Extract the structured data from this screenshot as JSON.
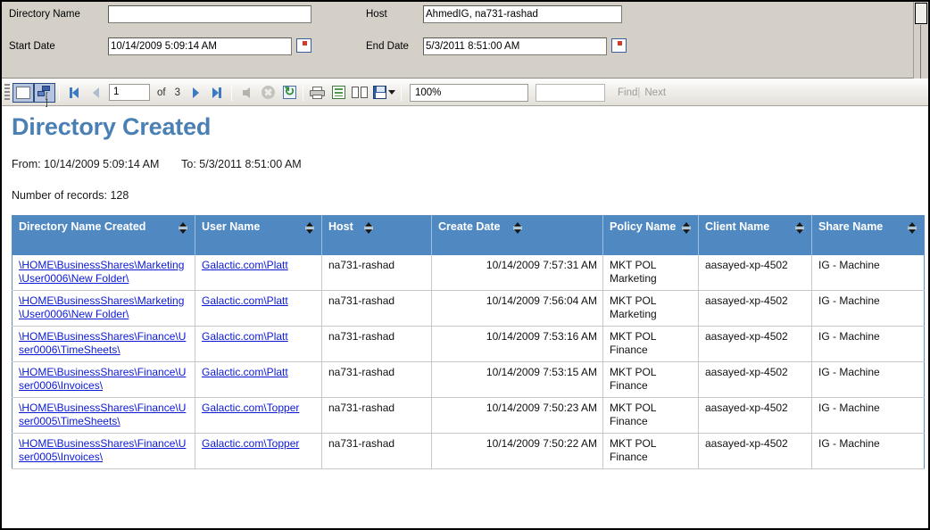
{
  "params": {
    "directory_name": {
      "label": "Directory Name",
      "value": "",
      "placeholder": ""
    },
    "host": {
      "label": "Host",
      "value": "AhmedIG, na731-rashad"
    },
    "start_date": {
      "label": "Start Date",
      "value": "10/14/2009 5:09:14 AM"
    },
    "end_date": {
      "label": "End Date",
      "value": "5/3/2011 8:51:00 AM"
    }
  },
  "toolbar": {
    "document_map_icon": "document-map-icon",
    "parameters_icon": "parameters-icon",
    "first_page_icon": "first-page-icon",
    "prev_page_icon": "previous-page-icon",
    "current_page": "1",
    "of_label": "of",
    "total_pages": "3",
    "next_page_icon": "next-page-icon",
    "last_page_icon": "last-page-icon",
    "back_icon": "back-parent-report-icon",
    "stop_icon": "stop-rendering-icon",
    "refresh_icon": "refresh-icon",
    "print_icon": "print-icon",
    "page_setup_icon": "page-setup-icon",
    "print_layout_icon": "print-layout-icon",
    "export_icon": "export-save-icon",
    "zoom_value": "100%",
    "find_label": "Find",
    "find_separator": "|",
    "next_label": "Next",
    "search_value": ""
  },
  "report": {
    "title": "Directory Created",
    "from_label": "From: 10/14/2009 5:09:14 AM",
    "to_label": "To: 5/3/2011 8:51:00 AM",
    "record_count_label": "Number of records: 128"
  },
  "table": {
    "columns": [
      {
        "label": "Directory Name Created",
        "sort": "sort-icon"
      },
      {
        "label": "User Name",
        "sort": "sort-icon"
      },
      {
        "label": "Host",
        "sort": "sort-icon"
      },
      {
        "label": "Create Date",
        "sort": "sort-icon"
      },
      {
        "label": "Policy Name",
        "sort": "sort-icon"
      },
      {
        "label": "Client Name",
        "sort": "sort-icon"
      },
      {
        "label": "Share Name",
        "sort": "sort-icon"
      }
    ],
    "rows": [
      {
        "directory": "\\HOME\\BusinessShares\\Marketing\\User0006\\New Folder\\",
        "user": "Galactic.com\\Platt",
        "host": "na731-rashad",
        "create_date": "10/14/2009 7:57:31 AM",
        "policy": "MKT POL Marketing",
        "client": "aasayed-xp-4502",
        "share": "IG - Machine"
      },
      {
        "directory": "\\HOME\\BusinessShares\\Marketing\\User0006\\New Folder\\",
        "user": "Galactic.com\\Platt",
        "host": "na731-rashad",
        "create_date": "10/14/2009 7:56:04 AM",
        "policy": "MKT POL Marketing",
        "client": "aasayed-xp-4502",
        "share": "IG - Machine"
      },
      {
        "directory": "\\HOME\\BusinessShares\\Finance\\User0006\\TimeSheets\\",
        "user": "Galactic.com\\Platt",
        "host": "na731-rashad",
        "create_date": "10/14/2009 7:53:16 AM",
        "policy": "MKT POL Finance",
        "client": "aasayed-xp-4502",
        "share": "IG - Machine"
      },
      {
        "directory": "\\HOME\\BusinessShares\\Finance\\User0006\\Invoices\\",
        "user": "Galactic.com\\Platt",
        "host": "na731-rashad",
        "create_date": "10/14/2009 7:53:15 AM",
        "policy": "MKT POL Finance",
        "client": "aasayed-xp-4502",
        "share": "IG - Machine"
      },
      {
        "directory": "\\HOME\\BusinessShares\\Finance\\User0005\\TimeSheets\\",
        "user": "Galactic.com\\Topper",
        "host": "na731-rashad",
        "create_date": "10/14/2009 7:50:23 AM",
        "policy": "MKT POL Finance",
        "client": "aasayed-xp-4502",
        "share": "IG - Machine"
      },
      {
        "directory": "\\HOME\\BusinessShares\\Finance\\User0005\\Invoices\\",
        "user": "Galactic.com\\Topper",
        "host": "na731-rashad",
        "create_date": "10/14/2009 7:50:22 AM",
        "policy": "MKT POL Finance",
        "client": "aasayed-xp-4502",
        "share": "IG - Machine"
      }
    ]
  },
  "colors": {
    "header_blue": "#5089c1",
    "title_blue": "#4a80b4",
    "link_blue": "#0b18d6",
    "panel_gray": "#d4d0c8"
  }
}
